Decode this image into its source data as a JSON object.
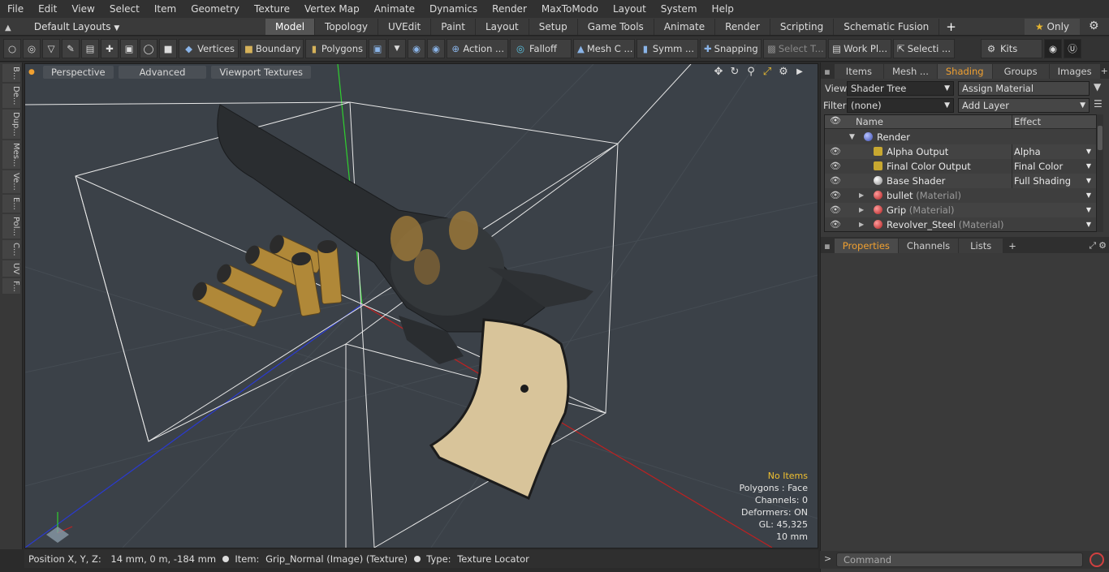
{
  "menu": [
    "File",
    "Edit",
    "View",
    "Select",
    "Item",
    "Geometry",
    "Texture",
    "Vertex Map",
    "Animate",
    "Dynamics",
    "Render",
    "MaxToModo",
    "Layout",
    "System",
    "Help"
  ],
  "layout_selector": "Default Layouts",
  "layout_tabs": [
    "Model",
    "Topology",
    "UVEdit",
    "Paint",
    "Layout",
    "Setup",
    "Game Tools",
    "Animate",
    "Render",
    "Scripting",
    "Schematic Fusion"
  ],
  "active_layout_tab": "Model",
  "only_label": "Only",
  "toolbar": {
    "vertices": "Vertices",
    "boundary": "Boundary",
    "polygons": "Polygons",
    "action": "Action ...",
    "falloff": "Falloff",
    "mesh": "Mesh C ...",
    "symm": "Symm ...",
    "snapping": "Snapping",
    "select_t": "Select T...",
    "work_pl": "Work Pl...",
    "selecti": "Selecti ...",
    "kits": "Kits"
  },
  "left_tabs": [
    "B...",
    "De...",
    "Dup...",
    "Mes...",
    "Ve...",
    "E...",
    "Pol...",
    "C...",
    "UV",
    "F..."
  ],
  "viewport": {
    "buttons": [
      "Perspective",
      "Advanced",
      "Viewport Textures"
    ],
    "info": {
      "items": "No Items",
      "polygons": "Polygons : Face",
      "channels": "Channels: 0",
      "deformers": "Deformers: ON",
      "gl": "GL: 45,325",
      "scale": "10 mm"
    }
  },
  "status": {
    "position_label": "Position X, Y, Z:",
    "position_value": "14 mm, 0 m, -184 mm",
    "item_label": "Item:",
    "item_value": "Grip_Normal (Image) (Texture)",
    "type_label": "Type:",
    "type_value": "Texture Locator"
  },
  "right_panel": {
    "tabs": [
      "Items",
      "Mesh ...",
      "Shading",
      "Groups",
      "Images"
    ],
    "active_tab": "Shading",
    "view_label": "View",
    "view_value": "Shader Tree",
    "assign_material": "Assign Material",
    "filter_label": "Filter",
    "filter_value": "(none)",
    "add_layer": "Add Layer",
    "col_name": "Name",
    "col_effect": "Effect",
    "rows": [
      {
        "name": "Render",
        "suffix": "",
        "effect": "",
        "indent": 0
      },
      {
        "name": "Alpha Output",
        "suffix": "",
        "effect": "Alpha",
        "indent": 1
      },
      {
        "name": "Final Color Output",
        "suffix": "",
        "effect": "Final Color",
        "indent": 1
      },
      {
        "name": "Base Shader",
        "suffix": "",
        "effect": "Full Shading",
        "indent": 1
      },
      {
        "name": "bullet",
        "suffix": "(Material)",
        "effect": "",
        "indent": 1
      },
      {
        "name": "Grip",
        "suffix": "(Material)",
        "effect": "",
        "indent": 1
      },
      {
        "name": "Revolver_Steel",
        "suffix": "(Material)",
        "effect": "",
        "indent": 1
      }
    ],
    "lower_tabs": [
      "Properties",
      "Channels",
      "Lists"
    ],
    "lower_active": "Properties"
  },
  "command_placeholder": "Command",
  "colors": {
    "accent": "#f0a030",
    "highlight_text": "#f0c030"
  }
}
